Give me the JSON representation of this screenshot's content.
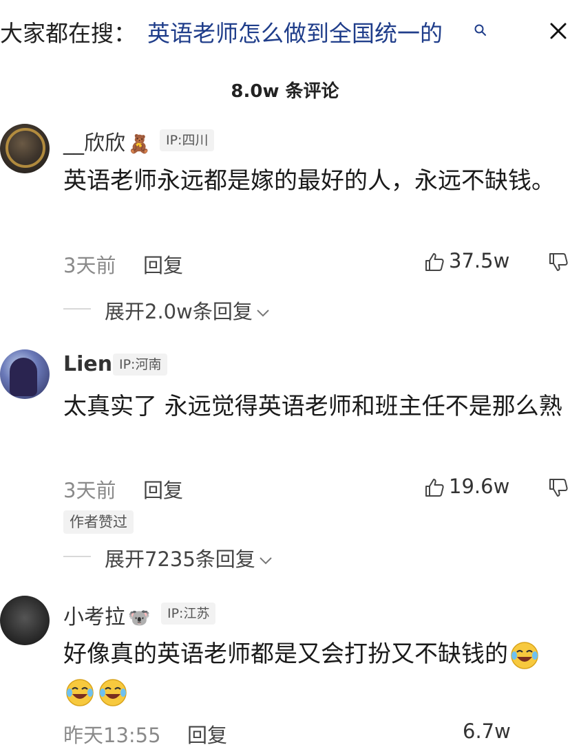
{
  "search": {
    "prefix": "大家都在搜：",
    "query": "英语老师怎么做到全国统一的"
  },
  "header": {
    "comment_count": "8.0w 条评论"
  },
  "comments": [
    {
      "username": "__欣欣",
      "name_emoji": "🧸",
      "ip": "IP:四川",
      "text": "英语老师永远都是嫁的最好的人，永远不缺钱。",
      "time": "3天前",
      "reply_label": "回复",
      "likes": "37.5w",
      "expand_label": "展开2.0w条回复"
    },
    {
      "username": "Lien",
      "ip": "IP:河南",
      "text": "太真实了 永远觉得英语老师和班主任不是那么熟",
      "time": "3天前",
      "reply_label": "回复",
      "likes": "19.6w",
      "author_liked": "作者赞过",
      "expand_label": "展开7235条回复"
    },
    {
      "username": "小考拉",
      "name_emoji": "🐨",
      "ip": "IP:江苏",
      "text": "好像真的英语老师都是又会打扮又不缺钱的",
      "time": "昨天13:55",
      "reply_label": "回复",
      "likes": "6.7w"
    }
  ],
  "colors": {
    "accent": "#1f3d8a",
    "muted": "#8a8a8a",
    "badge_bg": "#f2f2f2"
  }
}
